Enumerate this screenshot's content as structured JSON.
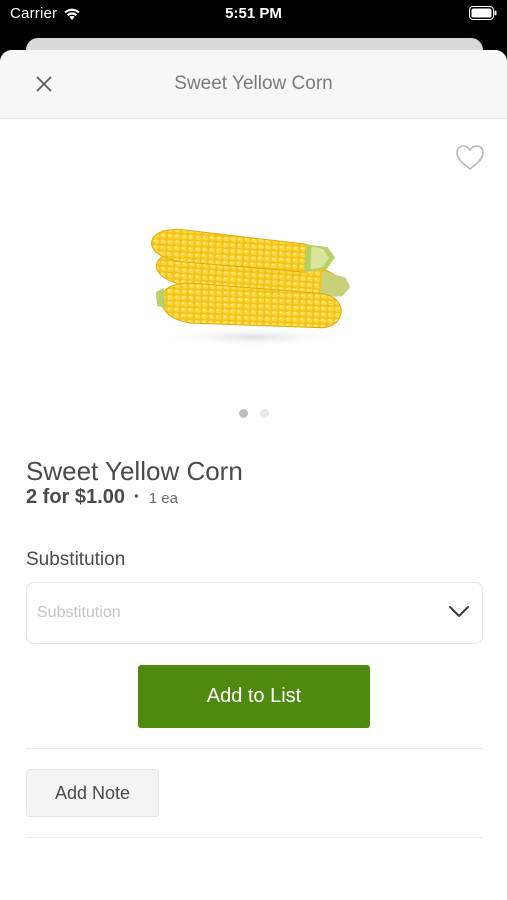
{
  "status_bar": {
    "carrier": "Carrier",
    "time": "5:51 PM"
  },
  "header": {
    "title": "Sweet Yellow Corn",
    "close_icon": "close-icon"
  },
  "product": {
    "name": "Sweet Yellow Corn",
    "price": "2 for $1.00",
    "separator": "·",
    "unit": "1 ea",
    "image_icon": "corn-image",
    "pager": {
      "count": 2,
      "active_index": 0
    }
  },
  "substitution": {
    "label": "Substitution",
    "placeholder": "Substitution"
  },
  "actions": {
    "add_to_list": "Add to List",
    "add_note": "Add Note"
  },
  "colors": {
    "primary_button": "#4f8a10",
    "header_background": "#f7f7f7",
    "text": "#4a4a4a"
  }
}
